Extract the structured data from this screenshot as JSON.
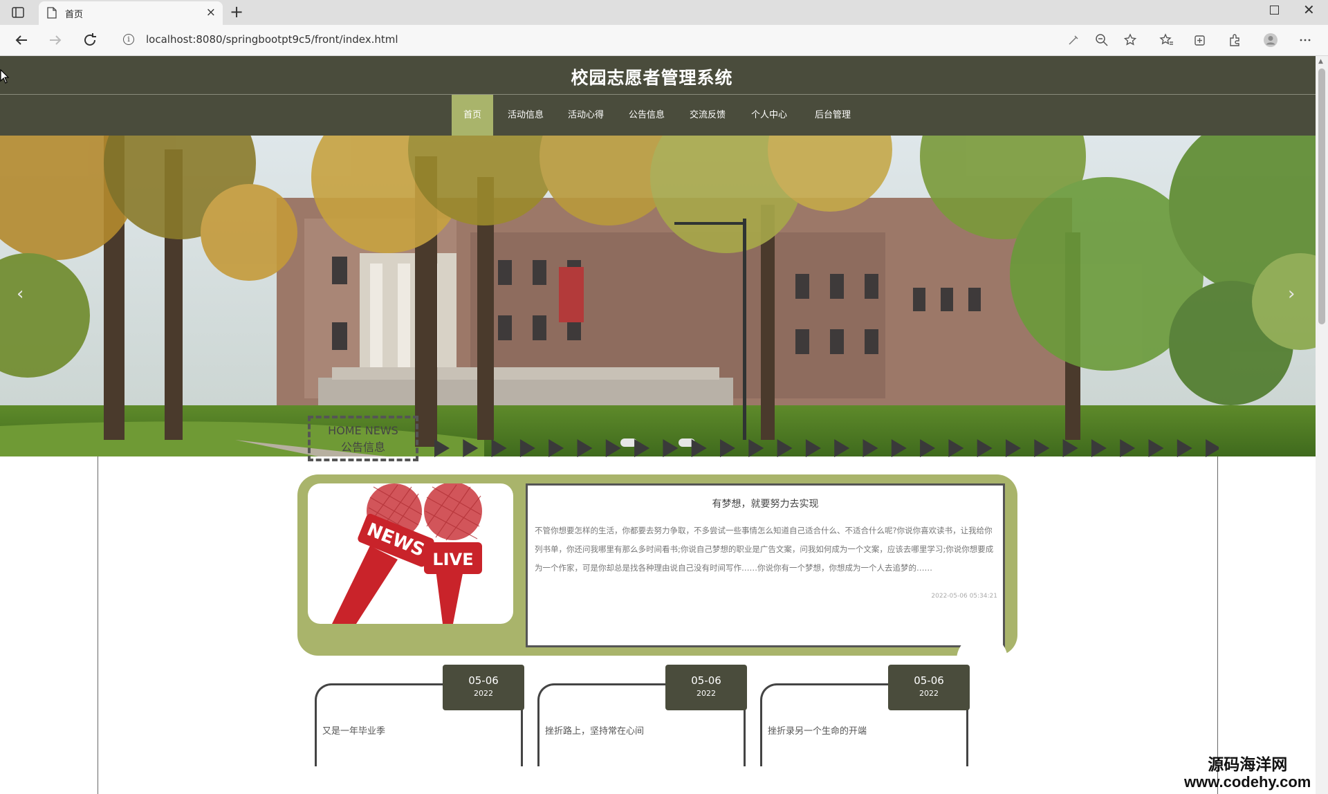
{
  "browser": {
    "tab_title": "首页",
    "url": "localhost:8080/springbootpt9c5/front/index.html"
  },
  "site": {
    "title": "校园志愿者管理系统",
    "nav": [
      {
        "label": "首页",
        "active": true
      },
      {
        "label": "活动信息",
        "active": false
      },
      {
        "label": "活动心得",
        "active": false
      },
      {
        "label": "公告信息",
        "active": false
      },
      {
        "label": "交流反馈",
        "active": false
      },
      {
        "label": "个人中心",
        "active": false
      },
      {
        "label": "后台管理",
        "active": false
      }
    ],
    "accent": "#a9b46b",
    "header_bg": "#4a4c3c"
  },
  "banner": {
    "prev_icon": "chevron-left-icon",
    "next_icon": "chevron-right-icon",
    "slide_count": 2
  },
  "news_section": {
    "title_en": "HOME NEWS",
    "title_cn": "公告信息",
    "featured": {
      "image_label_news": "NEWS",
      "image_label_live": "LIVE",
      "title": "有梦想，就要努力去实现",
      "body": "不管你想要怎样的生活，你都要去努力争取，不多尝试一些事情怎么知道自己适合什么、不适合什么呢?你说你喜欢读书，让我给你列书单，你还问我哪里有那么多时间看书;你说自己梦想的职业是广告文案，问我如何成为一个文案，应该去哪里学习;你说你想要成为一个作家，可是你却总是找各种理由说自己没有时间写作……你说你有一个梦想，你想成为一个人去追梦的……",
      "date": "2022-05-06 05:34:21"
    },
    "cards": [
      {
        "md": "05-06",
        "year": "2022",
        "title": "又是一年毕业季"
      },
      {
        "md": "05-06",
        "year": "2022",
        "title": "挫折路上，坚持常在心间"
      },
      {
        "md": "05-06",
        "year": "2022",
        "title": "挫折录另一个生命的开端"
      }
    ]
  },
  "watermark": {
    "cn": "源码海洋网",
    "url": "www.codehy.com"
  }
}
